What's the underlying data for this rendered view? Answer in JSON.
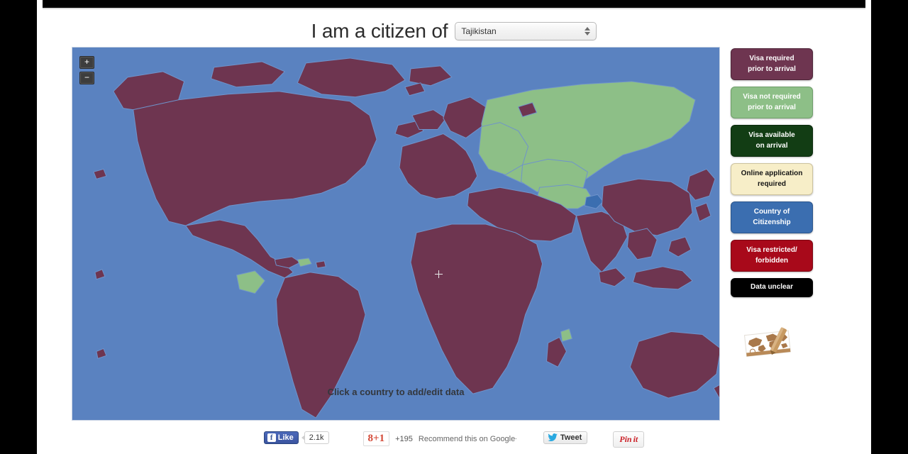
{
  "title": {
    "prefix": "I am a citizen of"
  },
  "select": {
    "value": "Tajikistan",
    "options": [
      "Tajikistan"
    ]
  },
  "map": {
    "hint": "Click a country to add/edit data",
    "zoom_in_label": "+",
    "zoom_out_label": "−",
    "ocean_color": "#5a82c0",
    "border_color": "#6f93cb",
    "colors": {
      "visa_required": "#6e3550",
      "visa_not_required": "#8dbf87",
      "visa_on_arrival": "#123d14",
      "online_application": "#f7eec8",
      "citizenship": "#3b6eb0",
      "restricted": "#a8091a",
      "unclear": "#000000"
    }
  },
  "legend": {
    "items": [
      {
        "label": "Visa required\nprior to arrival",
        "line1": "Visa required",
        "line2": "prior to arrival",
        "bg": "#6e3550",
        "fg": "#ffffff",
        "border": "#4e2539"
      },
      {
        "label": "Visa not required prior to arrival",
        "line1": "Visa not required",
        "line2": "prior to arrival",
        "bg": "#8dbf87",
        "fg": "#ffffff",
        "border": "#6f9e6a"
      },
      {
        "label": "Visa available on arrival",
        "line1": "Visa available",
        "line2": "on arrival",
        "bg": "#123d14",
        "fg": "#ffffff",
        "border": "#0a2a0c"
      },
      {
        "label": "Online application required",
        "line1": "Online application",
        "line2": "required",
        "bg": "#f7eec8",
        "fg": "#141414",
        "border": "#cdc39d"
      },
      {
        "label": "Country of Citizenship",
        "line1": "Country of",
        "line2": "Citizenship",
        "bg": "#3b6eb0",
        "fg": "#ffffff",
        "border": "#2c568c"
      },
      {
        "label": "Visa restricted/ forbidden",
        "line1": "Visa restricted/",
        "line2": "forbidden",
        "bg": "#a8091a",
        "fg": "#ffffff",
        "border": "#7d0713"
      },
      {
        "label": "Data unclear",
        "line1": "Data unclear",
        "line2": "",
        "bg": "#000000",
        "fg": "#ffffff",
        "border": "#000000"
      }
    ]
  },
  "social": {
    "facebook": {
      "label": "Like",
      "icon": "f",
      "count": "2.1k"
    },
    "google": {
      "icon": "8+1",
      "count": "+195",
      "text": "Recommend this on Google+"
    },
    "twitter": {
      "label": "Tweet"
    },
    "pinterest": {
      "label_pin": "Pin",
      "label_it": "it"
    }
  }
}
